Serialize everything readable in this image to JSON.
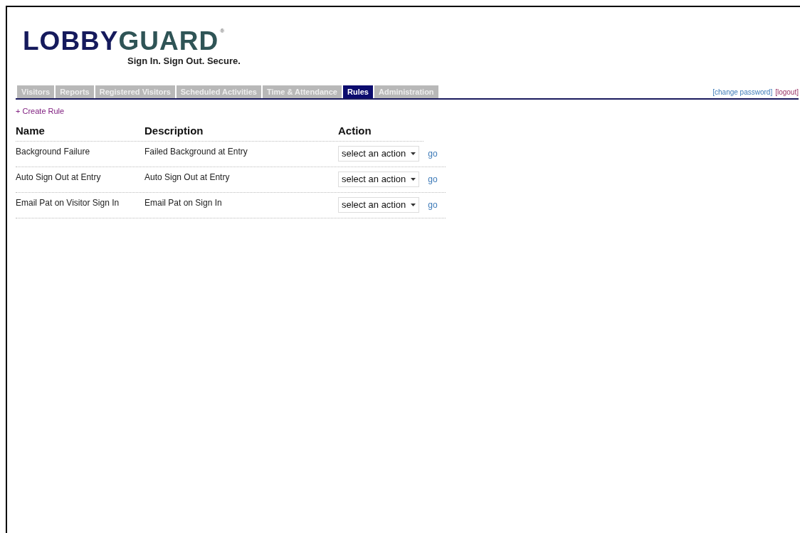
{
  "logo": {
    "text_first": "LOBBY",
    "text_second": "GUARD",
    "mark": "®",
    "tagline": "Sign In. Sign Out. Secure."
  },
  "tabs": [
    {
      "label": "Visitors",
      "selected": false
    },
    {
      "label": "Reports",
      "selected": false
    },
    {
      "label": "Registered Visitors",
      "selected": false
    },
    {
      "label": "Scheduled Activities",
      "selected": false
    },
    {
      "label": "Time & Attendance",
      "selected": false
    },
    {
      "label": "Rules",
      "selected": true
    },
    {
      "label": "Administration",
      "selected": false
    }
  ],
  "header_links": [
    {
      "label": "[change password]",
      "kind": "account"
    },
    {
      "label": "[logout]",
      "kind": "logout"
    }
  ],
  "create_link": "+ Create Rule",
  "table": {
    "columns": [
      "Name",
      "Description",
      "Action"
    ],
    "rows": [
      {
        "name": "Background Failure",
        "description": "Failed Background at Entry",
        "action": "select an action",
        "go": "go"
      },
      {
        "name": "Auto Sign Out at Entry",
        "description": "Auto Sign Out at Entry",
        "action": "select an action",
        "go": "go"
      },
      {
        "name": "Email Pat on Visitor Sign In",
        "description": "Email Pat on Sign In",
        "action": "select an action",
        "go": "go"
      }
    ]
  }
}
